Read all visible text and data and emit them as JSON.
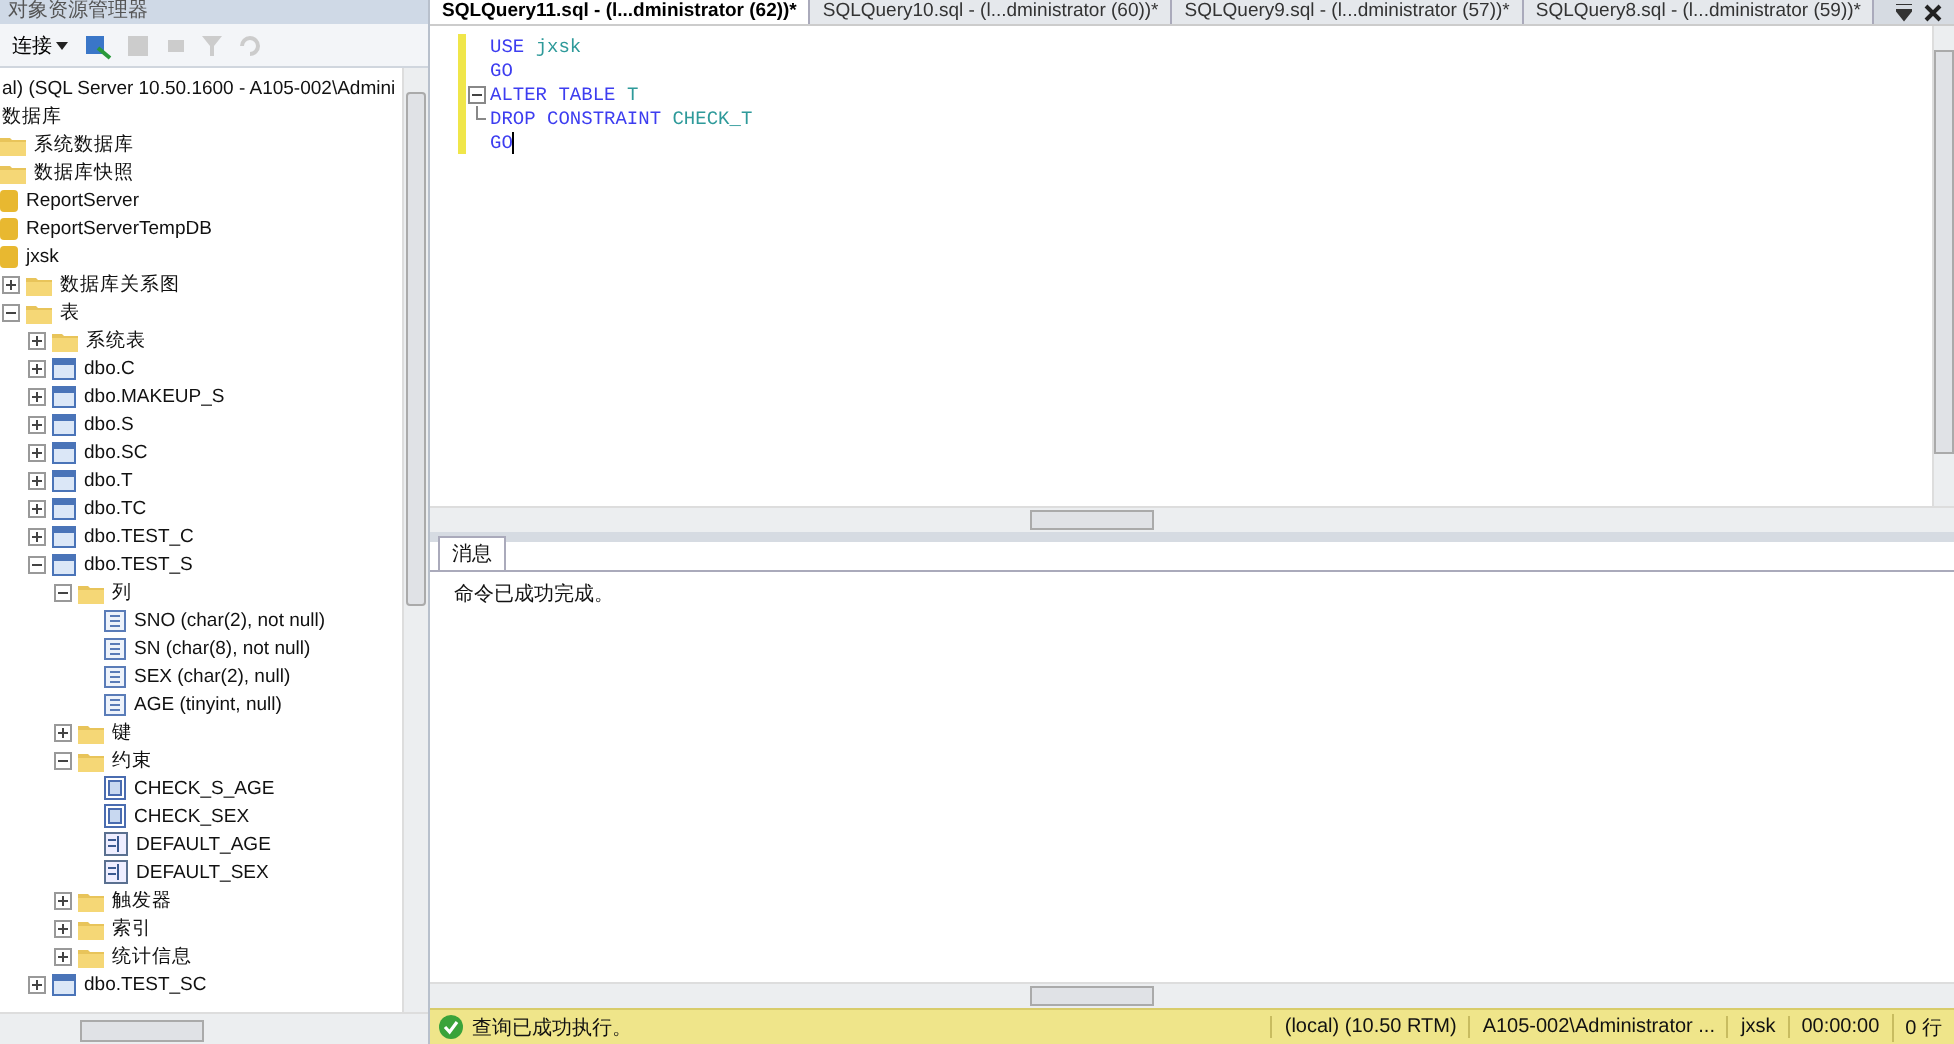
{
  "explorer": {
    "title": "对象资源管理器",
    "connect_button": "连接",
    "tree": [
      {
        "label": "al) (SQL Server 10.50.1600 - A105-002\\Admini",
        "children": [
          {
            "label": "数据库",
            "children": [
              {
                "label": "系统数据库",
                "kind": "folder"
              },
              {
                "label": "数据库快照",
                "kind": "folder"
              },
              {
                "label": "ReportServer",
                "kind": "db"
              },
              {
                "label": "ReportServerTempDB",
                "kind": "db"
              },
              {
                "label": "jxsk",
                "kind": "db",
                "children": [
                  {
                    "label": "数据库关系图",
                    "kind": "folder",
                    "expanded": false
                  },
                  {
                    "label": "表",
                    "kind": "folder",
                    "expanded": true,
                    "children": [
                      {
                        "label": "系统表",
                        "kind": "folder",
                        "expanded": false
                      },
                      {
                        "label": "dbo.C",
                        "kind": "table",
                        "expanded": false
                      },
                      {
                        "label": "dbo.MAKEUP_S",
                        "kind": "table",
                        "expanded": false
                      },
                      {
                        "label": "dbo.S",
                        "kind": "table",
                        "expanded": false
                      },
                      {
                        "label": "dbo.SC",
                        "kind": "table",
                        "expanded": false
                      },
                      {
                        "label": "dbo.T",
                        "kind": "table",
                        "expanded": false
                      },
                      {
                        "label": "dbo.TC",
                        "kind": "table",
                        "expanded": false
                      },
                      {
                        "label": "dbo.TEST_C",
                        "kind": "table",
                        "expanded": false
                      },
                      {
                        "label": "dbo.TEST_S",
                        "kind": "table",
                        "expanded": true,
                        "children": [
                          {
                            "label": "列",
                            "kind": "folder",
                            "expanded": true,
                            "children": [
                              {
                                "label": "SNO (char(2), not null)",
                                "kind": "column"
                              },
                              {
                                "label": "SN (char(8), not null)",
                                "kind": "column"
                              },
                              {
                                "label": "SEX (char(2), null)",
                                "kind": "column"
                              },
                              {
                                "label": "AGE (tinyint, null)",
                                "kind": "column"
                              }
                            ]
                          },
                          {
                            "label": "键",
                            "kind": "folder",
                            "expanded": false
                          },
                          {
                            "label": "约束",
                            "kind": "folder",
                            "expanded": true,
                            "children": [
                              {
                                "label": "CHECK_S_AGE",
                                "kind": "check"
                              },
                              {
                                "label": "CHECK_SEX",
                                "kind": "check"
                              },
                              {
                                "label": "DEFAULT_AGE",
                                "kind": "default"
                              },
                              {
                                "label": "DEFAULT_SEX",
                                "kind": "default"
                              }
                            ]
                          },
                          {
                            "label": "触发器",
                            "kind": "folder",
                            "expanded": false
                          },
                          {
                            "label": "索引",
                            "kind": "folder",
                            "expanded": false
                          },
                          {
                            "label": "统计信息",
                            "kind": "folder",
                            "expanded": false
                          }
                        ]
                      },
                      {
                        "label": "dbo.TEST_SC",
                        "kind": "table",
                        "expanded": false
                      }
                    ]
                  }
                ]
              }
            ]
          }
        ]
      }
    ]
  },
  "tabs": [
    {
      "label": "SQLQuery11.sql - (l...dministrator (62))*",
      "selected": true
    },
    {
      "label": "SQLQuery10.sql - (l...dministrator (60))*",
      "selected": false
    },
    {
      "label": "SQLQuery9.sql - (l...dministrator (57))*",
      "selected": false
    },
    {
      "label": "SQLQuery8.sql - (l...dministrator (59))*",
      "selected": false
    }
  ],
  "editor": {
    "lines": [
      {
        "kind": "plain",
        "tokens": [
          {
            "text": "USE",
            "kind": "keyword"
          },
          {
            "text": "jxsk",
            "kind": "ident"
          }
        ]
      },
      {
        "kind": "plain",
        "tokens": [
          {
            "text": "GO",
            "kind": "keyword"
          }
        ]
      },
      {
        "kind": "fold-start",
        "tokens": [
          {
            "text": "ALTER",
            "kind": "keyword"
          },
          {
            "text": "TABLE",
            "kind": "keyword"
          },
          {
            "text": "T",
            "kind": "ident"
          }
        ]
      },
      {
        "kind": "fold-end",
        "tokens": [
          {
            "text": "DROP",
            "kind": "keyword"
          },
          {
            "text": "CONSTRAINT",
            "kind": "keyword"
          },
          {
            "text": "CHECK_T",
            "kind": "ident"
          }
        ]
      },
      {
        "kind": "plain",
        "tokens": [
          {
            "text": "GO",
            "kind": "keyword"
          }
        ],
        "cursor": true
      }
    ]
  },
  "results": {
    "tab": "消息",
    "message": "命令已成功完成。"
  },
  "status_bar": {
    "message": "查询已成功执行。",
    "server": "(local) (10.50 RTM)",
    "user": "A105-002\\Administrator ...",
    "database": "jxsk",
    "elapsed": "00:00:00",
    "rows": "0 行"
  }
}
